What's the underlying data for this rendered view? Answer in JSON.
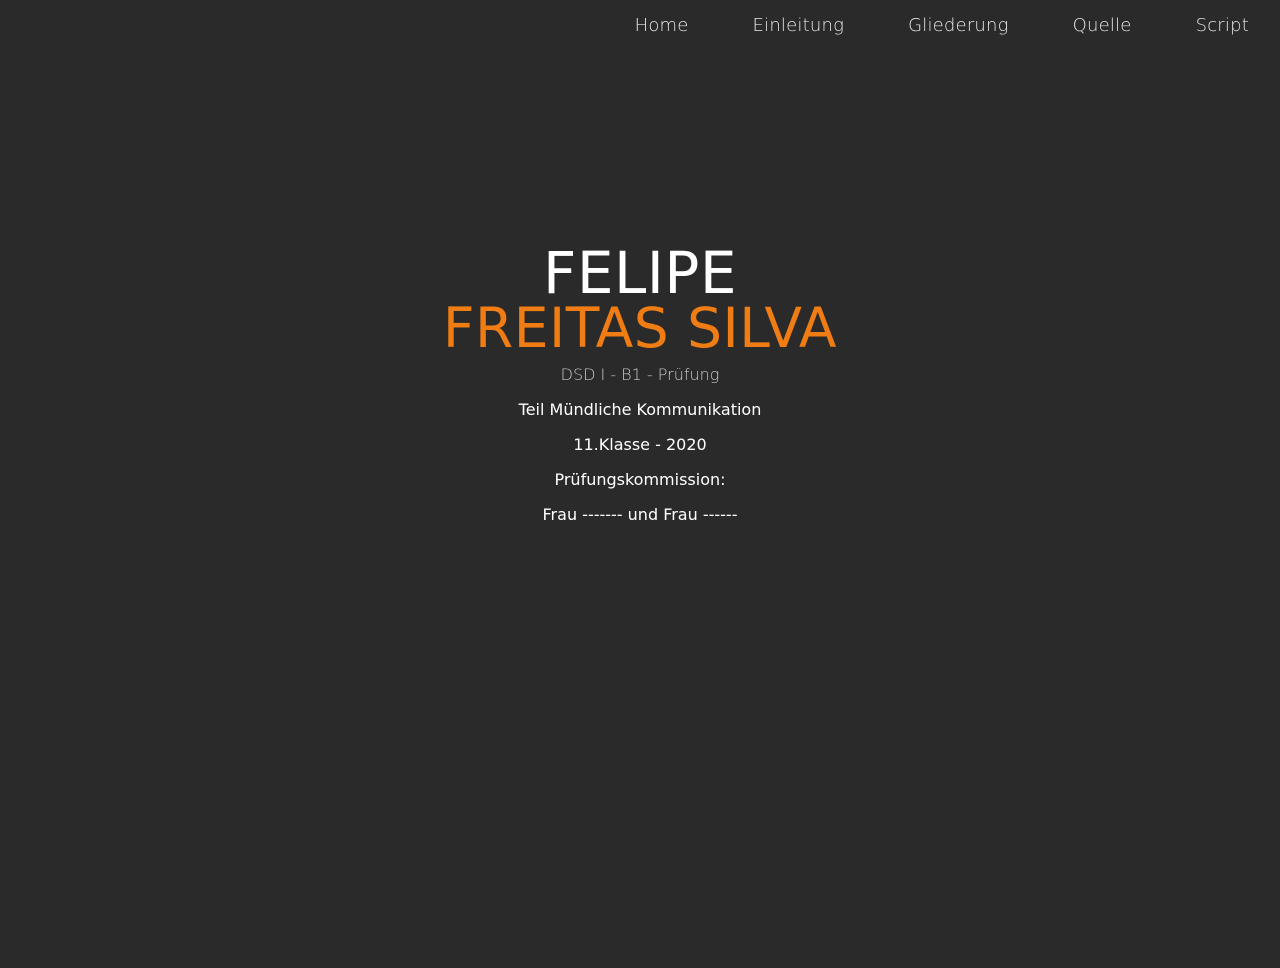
{
  "nav": {
    "items": [
      {
        "label": "Home"
      },
      {
        "label": "Einleitung"
      },
      {
        "label": "Gliederung"
      },
      {
        "label": "Quelle"
      },
      {
        "label": "Script"
      }
    ]
  },
  "hero": {
    "first_name": "FELIPE",
    "last_name": "FREITAS SILVA",
    "subtitle": "DSD I - B1 - Prüfung",
    "lines": [
      "Teil Mündliche Kommunikation",
      "11.Klasse - 2020",
      "Prüfungskommission:",
      "Frau ------- und Frau ------"
    ]
  },
  "colors": {
    "background": "#2a2a2a",
    "accent": "#f07c14",
    "text": "#ffffff"
  }
}
